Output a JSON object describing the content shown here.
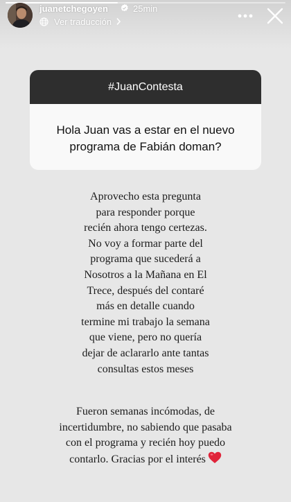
{
  "header": {
    "username": "juanetchegoyen",
    "timestamp": "25min",
    "translate_label": "Ver traducción",
    "icons": {
      "verified": "verified-badge-icon",
      "translate": "globe-icon",
      "more": "more-options-icon",
      "close": "close-icon"
    }
  },
  "progress": {
    "fraction": 0.4
  },
  "question": {
    "hashtag": "#JuanContesta",
    "lines": [
      "Hola Juan vas a estar en el nuevo",
      "programa de Fabián doman?"
    ]
  },
  "answer": {
    "paragraph1": [
      "Aprovecho esta pregunta",
      "para responder porque",
      "recién ahora tengo certezas.",
      "No voy a formar parte del",
      "programa que sucederá a",
      "Nosotros a la Mañana en El",
      "Trece, después del contaré",
      "más en detalle cuando",
      "termine mi trabajo la semana",
      "que viene, pero no quería",
      "dejar de aclararlo ante tantas",
      "consultas estos meses"
    ],
    "paragraph2": [
      "Fueron semanas incómodas, de",
      "incertidumbre, no sabiendo que pasaba",
      "con el programa y recién hoy puedo",
      "contarlo. Gracias por el interés"
    ],
    "emoji": "heart-emoji-icon"
  },
  "colors": {
    "background": "#e7e7e7",
    "question_header": "#2e2e2e",
    "heart": "#e0243a"
  }
}
